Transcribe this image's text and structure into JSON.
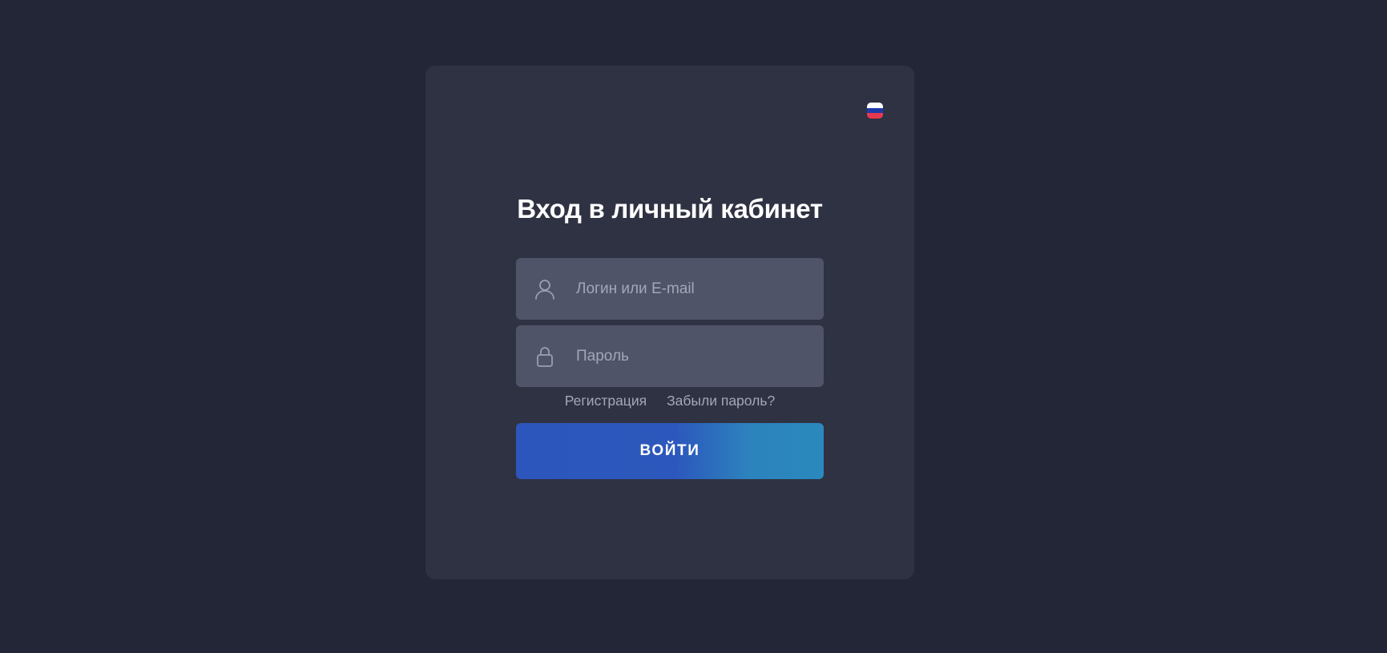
{
  "colors": {
    "background": "#232636",
    "card": "#2f3242",
    "field": "#4f5468",
    "placeholder": "#a3a7b8",
    "button_start": "#2c56bb",
    "button_end": "#2a89bd"
  },
  "language": {
    "icon": "russia-flag-icon",
    "flag_colors": [
      "#ffffff",
      "#1d3aa8",
      "#e6394f"
    ]
  },
  "login_form": {
    "title": "Вход в личный кабинет",
    "login_field": {
      "icon": "user-icon",
      "placeholder": "Логин или E-mail",
      "value": ""
    },
    "password_field": {
      "icon": "lock-icon",
      "placeholder": "Пароль",
      "value": ""
    },
    "links": {
      "register": "Регистрация",
      "forgot_password": "Забыли пароль?"
    },
    "submit_label": "ВОЙТИ"
  }
}
